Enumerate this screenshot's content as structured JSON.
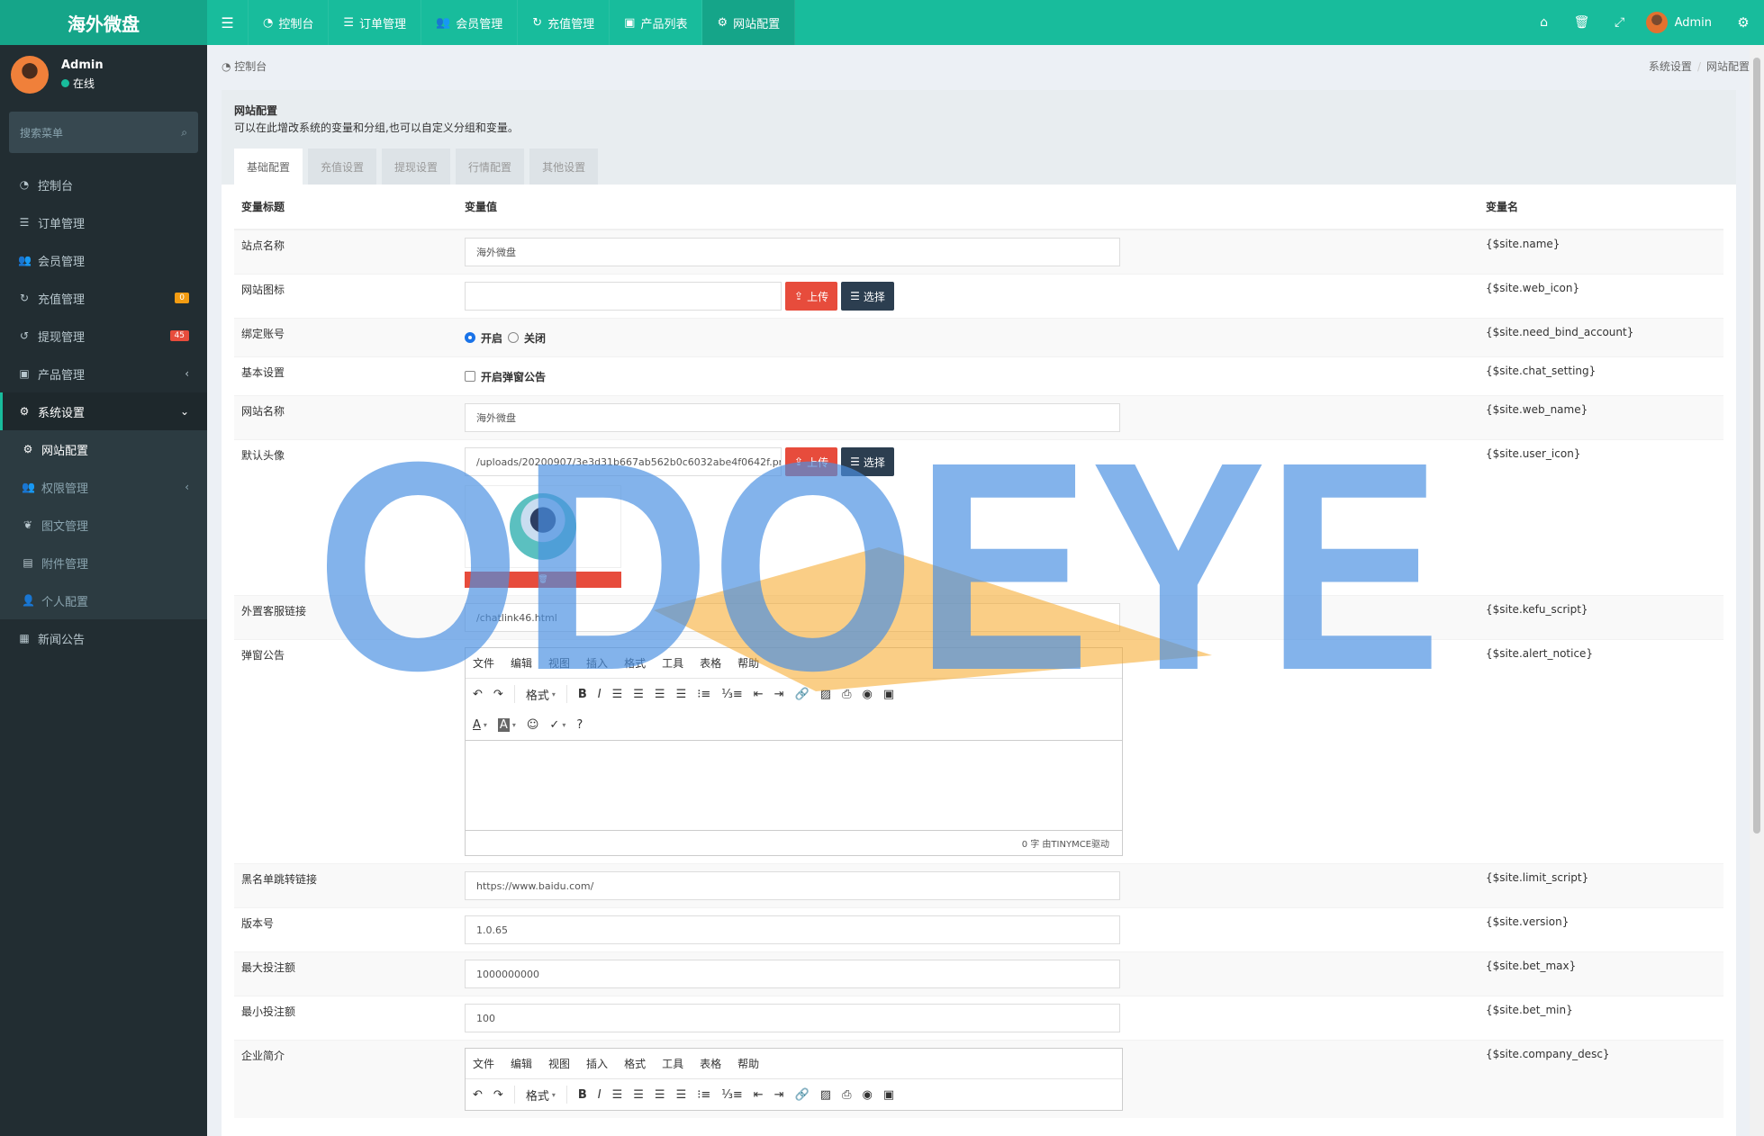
{
  "app": {
    "logo": "海外微盘"
  },
  "topnav": [
    {
      "label": "控制台",
      "icon": "dashboard-icon"
    },
    {
      "label": "订单管理",
      "icon": "list-icon"
    },
    {
      "label": "会员管理",
      "icon": "users-icon"
    },
    {
      "label": "充值管理",
      "icon": "recharge-icon"
    },
    {
      "label": "产品列表",
      "icon": "shop-icon"
    },
    {
      "label": "网站配置",
      "icon": "gear-icon"
    }
  ],
  "topright": {
    "user_name": "Admin"
  },
  "sidebar": {
    "user_name": "Admin",
    "status": "在线",
    "search_placeholder": "搜索菜单",
    "items": [
      {
        "label": "控制台"
      },
      {
        "label": "订单管理"
      },
      {
        "label": "会员管理"
      },
      {
        "label": "充值管理",
        "badge": "0"
      },
      {
        "label": "提现管理",
        "badge": "45"
      },
      {
        "label": "产品管理"
      },
      {
        "label": "系统设置"
      }
    ],
    "subitems": [
      {
        "label": "网站配置"
      },
      {
        "label": "权限管理"
      },
      {
        "label": "图文管理"
      },
      {
        "label": "附件管理"
      },
      {
        "label": "个人配置"
      }
    ],
    "last_item": {
      "label": "新闻公告"
    }
  },
  "breadcrumb": {
    "left": "控制台",
    "path1": "系统设置",
    "path2": "网站配置"
  },
  "panel": {
    "title": "网站配置",
    "desc": "可以在此增改系统的变量和分组,也可以自定义分组和变量。",
    "tabs": [
      "基础配置",
      "充值设置",
      "提现设置",
      "行情配置",
      "其他设置"
    ]
  },
  "table": {
    "headers": {
      "title": "变量标题",
      "value": "变量值",
      "name": "变量名"
    },
    "rows": {
      "site_name": {
        "title": "站点名称",
        "value": "海外微盘",
        "var": "{$site.name}"
      },
      "web_icon": {
        "title": "网站图标",
        "value": "",
        "var": "{$site.web_icon}"
      },
      "bind_account": {
        "title": "绑定账号",
        "opt_on": "开启",
        "opt_off": "关闭",
        "var": "{$site.need_bind_account}"
      },
      "basic": {
        "title": "基本设置",
        "checkbox_label": "开启弹窗公告",
        "var": "{$site.chat_setting}"
      },
      "web_name": {
        "title": "网站名称",
        "value": "海外微盘",
        "var": "{$site.web_name}"
      },
      "user_icon": {
        "title": "默认头像",
        "value": "/uploads/20200907/3e3d31b667ab562b0c6032abe4f0642f.pr",
        "var": "{$site.user_icon}"
      },
      "kefu": {
        "title": "外置客服链接",
        "value": "/chatlink46.html",
        "var": "{$site.kefu_script}"
      },
      "alert_notice": {
        "title": "弹窗公告",
        "var": "{$site.alert_notice}"
      },
      "limit": {
        "title": "黑名单跳转链接",
        "value": "https://www.baidu.com/",
        "var": "{$site.limit_script}"
      },
      "version": {
        "title": "版本号",
        "value": "1.0.65",
        "var": "{$site.version}"
      },
      "bet_max": {
        "title": "最大投注额",
        "value": "1000000000",
        "var": "{$site.bet_max}"
      },
      "bet_min": {
        "title": "最小投注额",
        "value": "100",
        "var": "{$site.bet_min}"
      },
      "company": {
        "title": "企业简介",
        "var": "{$site.company_desc}"
      }
    },
    "upload_label": "上传",
    "choose_label": "选择"
  },
  "editor": {
    "menus": [
      "文件",
      "编辑",
      "视图",
      "插入",
      "格式",
      "工具",
      "表格",
      "帮助"
    ],
    "format_label": "格式",
    "status": "0 字 由TINYMCE驱动"
  },
  "watermark": {
    "text": "ODOEYE",
    "color": "#4a90e2",
    "accent": "#f5a623"
  }
}
